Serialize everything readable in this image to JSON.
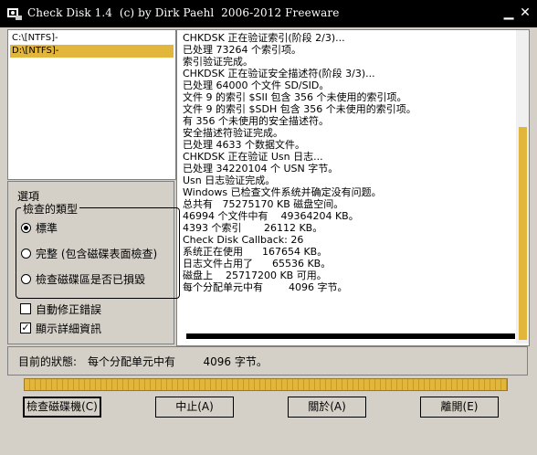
{
  "window": {
    "title": "Check Disk 1.4  (c) by Dirk Paehl  2006-2012 Freeware",
    "minimize_glyph": "▁",
    "close_glyph": "✕"
  },
  "drives": [
    {
      "label": "C:\\[NTFS]-",
      "selected": false
    },
    {
      "label": "D:\\[NTFS]-",
      "selected": true
    }
  ],
  "log_lines": [
    "CHKDSK 正在验证索引(阶段 2/3)...",
    "已处理 73264 个索引项。",
    "索引验证完成。",
    "CHKDSK 正在验证安全描述符(阶段 3/3)...",
    "已处理 64000 个文件 SD/SID。",
    "文件 9 的索引 $SII 包含 356 个未使用的索引项。",
    "文件 9 的索引 $SDH 包含 356 个未使用的索引项。",
    "有 356 个未使用的安全描述符。",
    "安全描述符验证完成。",
    "已处理 4633 个数据文件。",
    "CHKDSK 正在验证 Usn 日志...",
    "已处理 34220104 个 USN 字节。",
    "Usn 日志验证完成。",
    "Windows 已检查文件系统并确定没有问题。",
    "总共有   75275170 KB 磁盘空间。",
    "46994 个文件中有    49364204 KB。",
    "4393 个索引       26112 KB。",
    "Check Disk Callback: 26",
    "系统正在使用      167654 KB。",
    "日志文件占用了      65536 KB。",
    "磁盘上    25717200 KB 可用。",
    "每个分配单元中有        4096 字节。"
  ],
  "options": {
    "legend": "選項",
    "group_legend": "檢查的類型",
    "radios": [
      {
        "label": "標準",
        "checked": true
      },
      {
        "label": "完整 (包含磁碟表面檢查)",
        "checked": false
      },
      {
        "label": "檢查磁碟區是否已損毀",
        "checked": false
      }
    ],
    "checkboxes": [
      {
        "label": "自動修正錯誤",
        "checked": false
      },
      {
        "label": "顯示詳細資訊",
        "checked": true
      }
    ],
    "check_glyph": "✓"
  },
  "status": {
    "label": "目前的狀態:",
    "text": "每个分配单元中有        4096 字节。"
  },
  "progress": {
    "percent": 100
  },
  "buttons": {
    "check": "檢查磁碟機(C)",
    "stop": "中止(A)",
    "about": "關於(A)",
    "exit": "離開(E)"
  },
  "colors": {
    "accent": "#e2b53b",
    "titlebar": "#000000",
    "face": "#d4d0c8"
  }
}
